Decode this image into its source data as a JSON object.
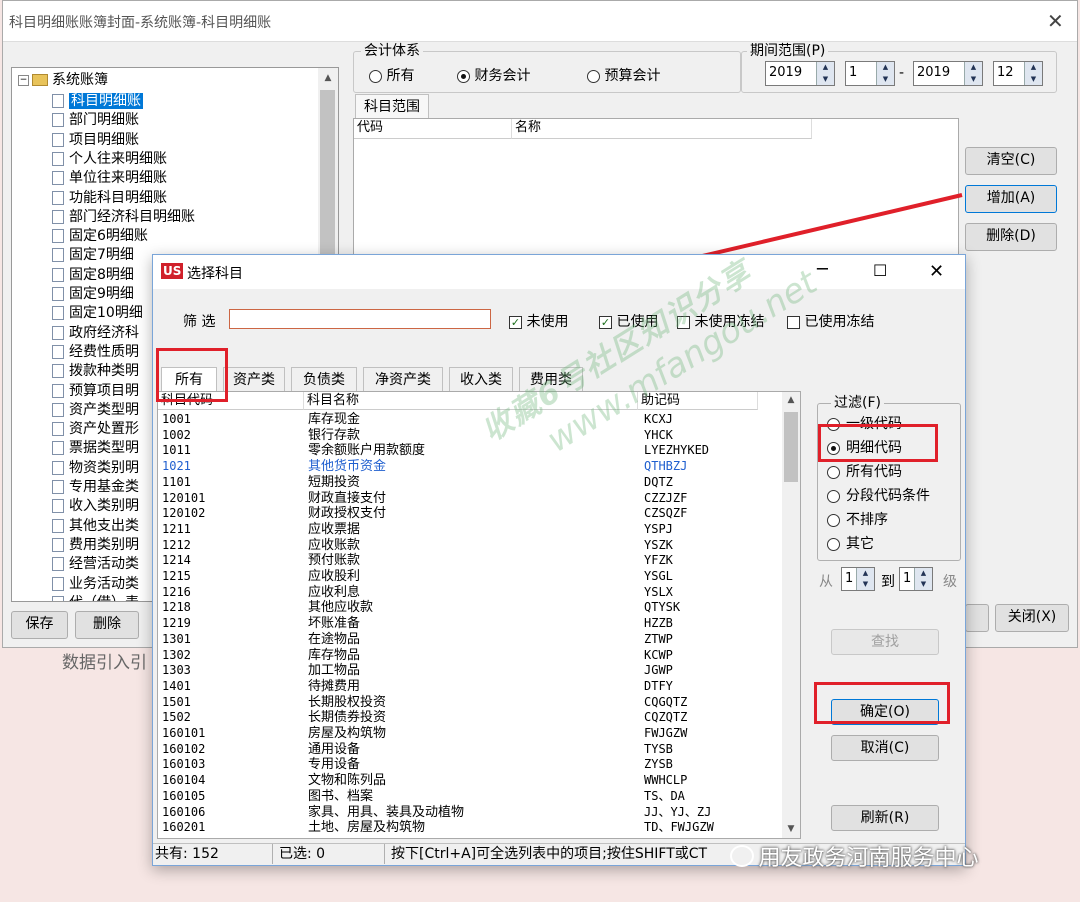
{
  "main_window": {
    "title": "科目明细账账簿封面-系统账簿-科目明细账",
    "tree": {
      "root": "系统账簿",
      "items": [
        "科目明细账",
        "部门明细账",
        "项目明细账",
        "个人往来明细账",
        "单位往来明细账",
        "功能科目明细账",
        "部门经济科目明细账",
        "固定6明细账",
        "固定7明细",
        "固定8明细",
        "固定9明细",
        "固定10明细",
        "政府经济科",
        "经费性质明",
        "拨款种类明",
        "预算项目明",
        "资产类型明",
        "资产处置形",
        "票据类型明",
        "物资类别明",
        "专用基金类",
        "收入类别明",
        "其他支出类",
        "费用类别明",
        "经营活动类",
        "业务活动类",
        "代（借）表"
      ]
    },
    "accounting_system": {
      "label": "会计体系",
      "options": [
        "所有",
        "财务会计",
        "预算会计"
      ],
      "selected": "财务会计"
    },
    "period": {
      "label": "期间范围(P)",
      "from_year": "2019",
      "from_month": "1",
      "dash": "-",
      "to_year": "2019",
      "to_month": "12"
    },
    "subject_range_tab": "科目范围",
    "columns": [
      "代码",
      "名称"
    ],
    "buttons": {
      "clear": "清空(C)",
      "add": "增加(A)",
      "delete": "删除(D)",
      "close": "关闭(X)",
      "save": "保存",
      "remove": "删除"
    },
    "footer_text": "数据引入引"
  },
  "dialog": {
    "title": "选择科目",
    "logo": "US",
    "filter_label": "筛 选",
    "filter_value": "",
    "checks": [
      {
        "label": "未使用",
        "checked": true
      },
      {
        "label": "已使用",
        "checked": true
      },
      {
        "label": "未使用冻结",
        "checked": false
      },
      {
        "label": "已使用冻结",
        "checked": false
      }
    ],
    "tabs": [
      "所有",
      "资产类",
      "负债类",
      "净资产类",
      "收入类",
      "费用类"
    ],
    "active_tab": "所有",
    "columns": [
      "科目代码",
      "科目名称",
      "助记码"
    ],
    "rows": [
      [
        "1001",
        "库存现金",
        "KCXJ"
      ],
      [
        "1002",
        "银行存款",
        "YHCK"
      ],
      [
        "1011",
        "零余额账户用款额度",
        "LYEZHYKED"
      ],
      [
        "1021",
        "其他货币资金",
        "QTHBZJ"
      ],
      [
        "1101",
        "短期投资",
        "DQTZ"
      ],
      [
        "120101",
        "财政直接支付",
        "CZZJZF"
      ],
      [
        "120102",
        "财政授权支付",
        "CZSQZF"
      ],
      [
        "1211",
        "应收票据",
        "YSPJ"
      ],
      [
        "1212",
        "应收账款",
        "YSZK"
      ],
      [
        "1214",
        "预付账款",
        "YFZK"
      ],
      [
        "1215",
        "应收股利",
        "YSGL"
      ],
      [
        "1216",
        "应收利息",
        "YSLX"
      ],
      [
        "1218",
        "其他应收款",
        "QTYSK"
      ],
      [
        "1219",
        "坏账准备",
        "HZZB"
      ],
      [
        "1301",
        "在途物品",
        "ZTWP"
      ],
      [
        "1302",
        "库存物品",
        "KCWP"
      ],
      [
        "1303",
        "加工物品",
        "JGWP"
      ],
      [
        "1401",
        "待摊费用",
        "DTFY"
      ],
      [
        "1501",
        "长期股权投资",
        "CQGQTZ"
      ],
      [
        "1502",
        "长期债券投资",
        "CQZQTZ"
      ],
      [
        "160101",
        "房屋及构筑物",
        "FWJGZW"
      ],
      [
        "160102",
        "通用设备",
        "TYSB"
      ],
      [
        "160103",
        "专用设备",
        "ZYSB"
      ],
      [
        "160104",
        "文物和陈列品",
        "WWHCLP"
      ],
      [
        "160105",
        "图书、档案",
        "TS、DA"
      ],
      [
        "160106",
        "家具、用具、装具及动植物",
        "JJ、YJ、ZJ"
      ],
      [
        "160201",
        "土地、房屋及构筑物",
        "TD、FWJGZW"
      ]
    ],
    "highlight_row": 3,
    "filter_group": {
      "label": "过滤(F)",
      "options": [
        "一级代码",
        "明细代码",
        "所有代码",
        "分段代码条件",
        "不排序",
        "其它"
      ],
      "selected": "明细代码"
    },
    "level": {
      "from_label": "从",
      "from": "1",
      "to_label": "到",
      "to": "1",
      "unit": "级"
    },
    "buttons": {
      "find": "查找",
      "ok": "确定(O)",
      "cancel": "取消(C)",
      "refresh": "刷新(R)"
    },
    "status": {
      "total": "共有: 152",
      "selected": "已选: 0",
      "hint": "按下[Ctrl+A]可全选列表中的项目;按住SHIFT或CT"
    }
  },
  "watermark": {
    "line1": "收藏6号社区知识分享",
    "line2": "www.mfangou.net"
  },
  "wechat_caption": "用友政务河南服务中心",
  "colors": {
    "highlight": "#0078d7",
    "red_mark": "#e0202a",
    "link_blue": "#1f5fcf"
  }
}
